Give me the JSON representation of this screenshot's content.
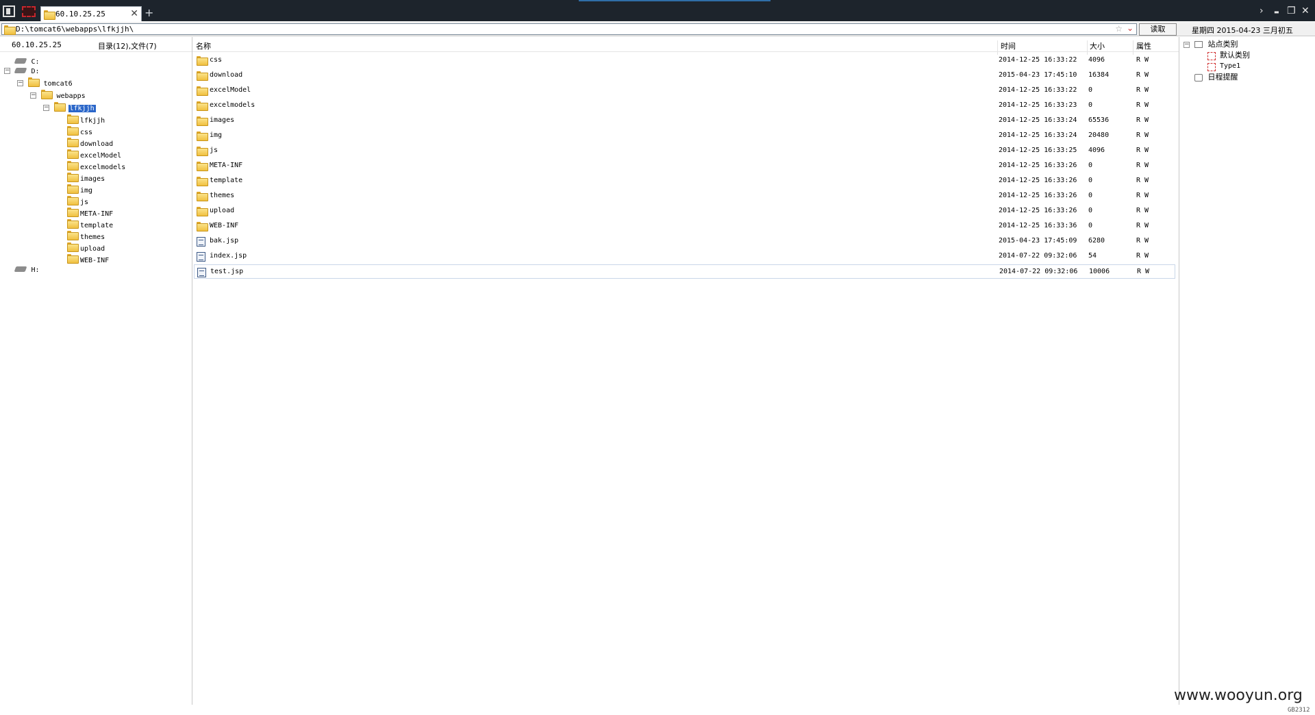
{
  "titlebar": {
    "tab_title": "60.10.25.25",
    "tab_close": "✕",
    "tab_add": "+",
    "controls": {
      "forward": "›",
      "minimize": "▬",
      "restore": "❐",
      "close": "✕"
    }
  },
  "address": {
    "path": "D:\\tomcat6\\webapps\\lfkjjh\\",
    "read_button": "读取",
    "date_info": "星期四 2015-04-23 三月初五"
  },
  "left_panel": {
    "host": "60.10.25.25",
    "counts": "目录(12),文件(7)",
    "tree": {
      "drive_c": "C:",
      "drive_d": "D:",
      "tomcat6": "tomcat6",
      "webapps": "webapps",
      "lfkjjh": "lfkjjh",
      "children": [
        "lfkjjh",
        "css",
        "download",
        "excelModel",
        "excelmodels",
        "images",
        "img",
        "js",
        "META-INF",
        "template",
        "themes",
        "upload",
        "WEB-INF"
      ],
      "drive_h": "H:"
    }
  },
  "main": {
    "columns": {
      "name": "名称",
      "time": "时间",
      "size": "大小",
      "attr": "属性"
    },
    "rows": [
      {
        "name": "css",
        "type": "folder",
        "time": "2014-12-25 16:33:22",
        "size": "4096",
        "attr": "R W"
      },
      {
        "name": "download",
        "type": "folder",
        "time": "2015-04-23 17:45:10",
        "size": "16384",
        "attr": "R W"
      },
      {
        "name": "excelModel",
        "type": "folder",
        "time": "2014-12-25 16:33:22",
        "size": "0",
        "attr": "R W"
      },
      {
        "name": "excelmodels",
        "type": "folder",
        "time": "2014-12-25 16:33:23",
        "size": "0",
        "attr": "R W"
      },
      {
        "name": "images",
        "type": "folder",
        "time": "2014-12-25 16:33:24",
        "size": "65536",
        "attr": "R W"
      },
      {
        "name": "img",
        "type": "folder",
        "time": "2014-12-25 16:33:24",
        "size": "20480",
        "attr": "R W"
      },
      {
        "name": "js",
        "type": "folder",
        "time": "2014-12-25 16:33:25",
        "size": "4096",
        "attr": "R W"
      },
      {
        "name": "META-INF",
        "type": "folder",
        "time": "2014-12-25 16:33:26",
        "size": "0",
        "attr": "R W"
      },
      {
        "name": "template",
        "type": "folder",
        "time": "2014-12-25 16:33:26",
        "size": "0",
        "attr": "R W"
      },
      {
        "name": "themes",
        "type": "folder",
        "time": "2014-12-25 16:33:26",
        "size": "0",
        "attr": "R W"
      },
      {
        "name": "upload",
        "type": "folder",
        "time": "2014-12-25 16:33:26",
        "size": "0",
        "attr": "R W"
      },
      {
        "name": "WEB-INF",
        "type": "folder",
        "time": "2014-12-25 16:33:36",
        "size": "0",
        "attr": "R W"
      },
      {
        "name": "bak.jsp",
        "type": "file",
        "time": "2015-04-23 17:45:09",
        "size": "6280",
        "attr": "R W"
      },
      {
        "name": "index.jsp",
        "type": "file",
        "time": "2014-07-22 09:32:06",
        "size": "54",
        "attr": "R W"
      },
      {
        "name": "test.jsp",
        "type": "file",
        "time": "2014-07-22 09:32:06",
        "size": "10006",
        "attr": "R W"
      }
    ]
  },
  "right_panel": {
    "site_category": "站点类别",
    "default_category": "默认类别",
    "type1": "Type1",
    "schedule": "日程提醒"
  },
  "watermark": "www.wooyun.org",
  "encoding": "GB2312",
  "colors": {
    "titlebar": "#1d242c",
    "selection": "#2a66c9",
    "folder": "#f0c040"
  }
}
